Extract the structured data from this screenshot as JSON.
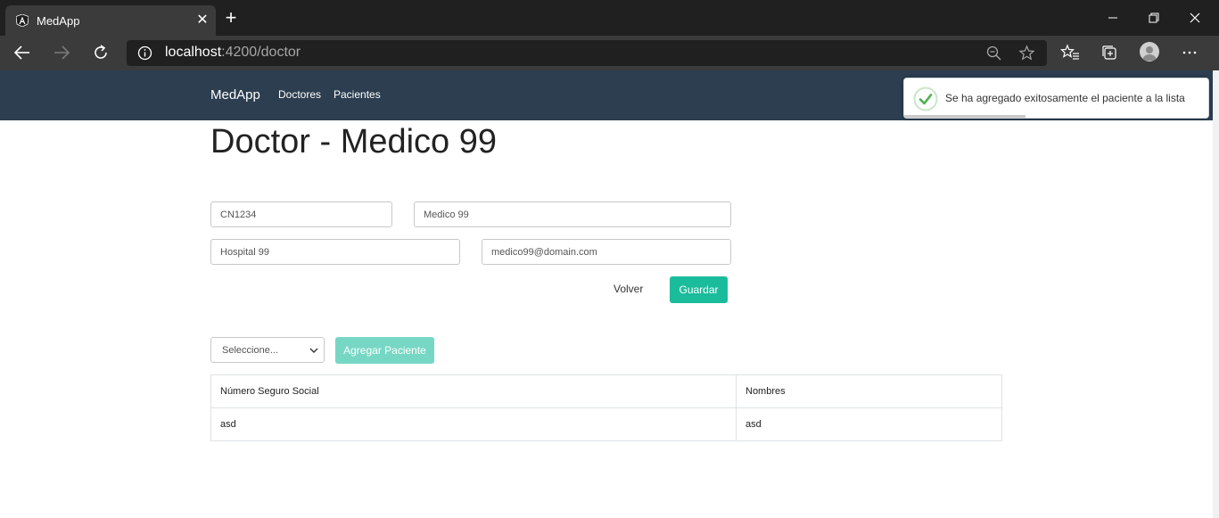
{
  "browser": {
    "tab_title": "MedApp",
    "url_host": "localhost",
    "url_rest": ":4200/doctor"
  },
  "navbar": {
    "brand": "MedApp",
    "links": [
      "Doctores",
      "Pacientes"
    ]
  },
  "toast": {
    "message": "Se ha agregado exitosamente el paciente a la lista",
    "status_color": "#4caf50",
    "progress": 0.4
  },
  "page": {
    "title": "Doctor - Medico 99"
  },
  "form": {
    "code": "CN1234",
    "name": "Medico 99",
    "hospital": "Hospital 99",
    "email": "medico99@domain.com",
    "back_label": "Volver",
    "save_label": "Guardar"
  },
  "patients": {
    "select_value": "Seleccione...",
    "add_label": "Agregar Paciente",
    "columns": [
      "Número Seguro Social",
      "Nombres"
    ],
    "rows": [
      [
        "asd",
        "asd"
      ]
    ]
  },
  "colors": {
    "navbar": "#2c3e50",
    "primary": "#1abc9c",
    "primary_disabled": "#76d7c4"
  },
  "icons": {
    "favicon": "angular-icon",
    "back": "arrow-left-icon",
    "forward": "arrow-right-icon",
    "refresh": "refresh-icon",
    "site_info": "info-icon",
    "zoom": "zoom-out-icon",
    "favorite": "star-icon",
    "favorites": "favorites-list-icon",
    "collections": "collections-icon",
    "profile": "profile-icon",
    "menu": "more-icon",
    "toast": "check-icon"
  }
}
